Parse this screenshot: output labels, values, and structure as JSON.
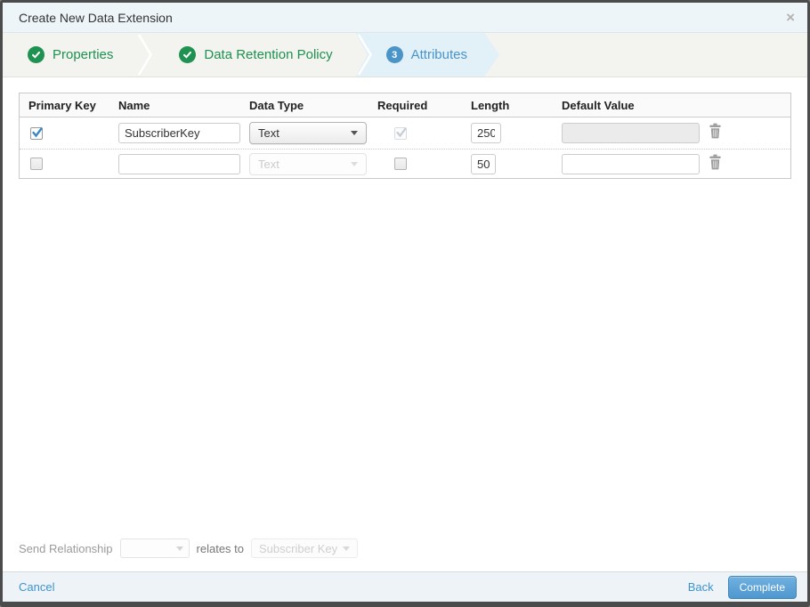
{
  "modal": {
    "title": "Create New Data Extension",
    "close_glyph": "×"
  },
  "wizard": {
    "steps": [
      {
        "label": "Properties",
        "status": "complete"
      },
      {
        "label": "Data Retention Policy",
        "status": "complete"
      },
      {
        "label": "Attributes",
        "status": "active",
        "number": "3"
      }
    ]
  },
  "table": {
    "headers": {
      "primary_key": "Primary Key",
      "name": "Name",
      "data_type": "Data Type",
      "required": "Required",
      "length": "Length",
      "default_value": "Default Value"
    },
    "rows": [
      {
        "primary_key_checked": true,
        "name": "SubscriberKey",
        "data_type": "Text",
        "required_checked": true,
        "required_disabled": true,
        "length": "250",
        "default_value": "",
        "default_value_disabled": true
      },
      {
        "primary_key_checked": false,
        "name": "",
        "data_type": "Text",
        "data_type_disabled": true,
        "required_checked": false,
        "length": "50",
        "default_value": "",
        "default_value_disabled": false
      }
    ]
  },
  "send_relationship": {
    "label": "Send Relationship",
    "relates_to": "relates to",
    "target_field": "Subscriber Key"
  },
  "footer": {
    "cancel": "Cancel",
    "back": "Back",
    "complete": "Complete"
  },
  "colors": {
    "success_green": "#1f9150",
    "accent_blue": "#4a94c8",
    "link_blue": "#3e94cc",
    "active_step_bg": "#e2f0f8",
    "footer_bg": "#eef3f7",
    "titlebar_bg": "#eef5f8"
  }
}
